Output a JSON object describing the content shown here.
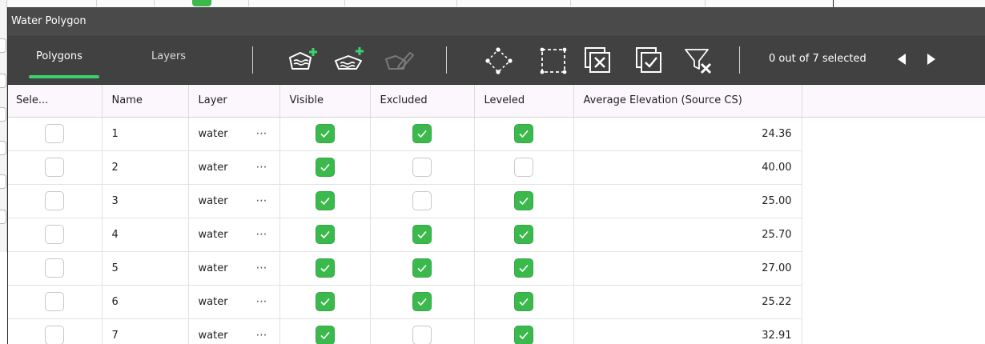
{
  "panel": {
    "title": "Water Polygon"
  },
  "tabs": [
    {
      "label": "Polygons",
      "active": true
    },
    {
      "label": "Layers",
      "active": false
    }
  ],
  "toolbar": {
    "tools": [
      {
        "name": "add-water-polygon-icon",
        "enabled": true
      },
      {
        "name": "add-layer-polygon-icon",
        "enabled": true
      },
      {
        "name": "edit-polygon-icon",
        "enabled": false
      },
      {
        "name": "select-polygon-icon",
        "enabled": true
      },
      {
        "name": "select-rectangle-icon",
        "enabled": true
      },
      {
        "name": "exclude-selected-icon",
        "enabled": true
      },
      {
        "name": "include-selected-icon",
        "enabled": true
      },
      {
        "name": "clear-filter-icon",
        "enabled": true
      }
    ],
    "selection_text": "0 out of 7 selected"
  },
  "colors": {
    "accent": "#3bd16f",
    "check_on": "#3cb94d",
    "toolbar_bg": "#414141",
    "title_bg": "#4a4a4a"
  },
  "table": {
    "columns": [
      "Sele...",
      "Name",
      "Layer",
      "Visible",
      "Excluded",
      "Leveled",
      "Average Elevation (Source CS)"
    ],
    "rows": [
      {
        "selected": false,
        "name": "1",
        "layer": "water",
        "visible": true,
        "excluded": true,
        "leveled": true,
        "elevation": "24.36"
      },
      {
        "selected": false,
        "name": "2",
        "layer": "water",
        "visible": true,
        "excluded": false,
        "leveled": false,
        "elevation": "40.00"
      },
      {
        "selected": false,
        "name": "3",
        "layer": "water",
        "visible": true,
        "excluded": false,
        "leveled": true,
        "elevation": "25.00"
      },
      {
        "selected": false,
        "name": "4",
        "layer": "water",
        "visible": true,
        "excluded": true,
        "leveled": true,
        "elevation": "25.70"
      },
      {
        "selected": false,
        "name": "5",
        "layer": "water",
        "visible": true,
        "excluded": true,
        "leveled": true,
        "elevation": "27.00"
      },
      {
        "selected": false,
        "name": "6",
        "layer": "water",
        "visible": true,
        "excluded": true,
        "leveled": true,
        "elevation": "25.22"
      },
      {
        "selected": false,
        "name": "7",
        "layer": "water",
        "visible": true,
        "excluded": false,
        "leveled": true,
        "elevation": "32.91"
      }
    ],
    "more_icon": "ellipsis-icon"
  }
}
